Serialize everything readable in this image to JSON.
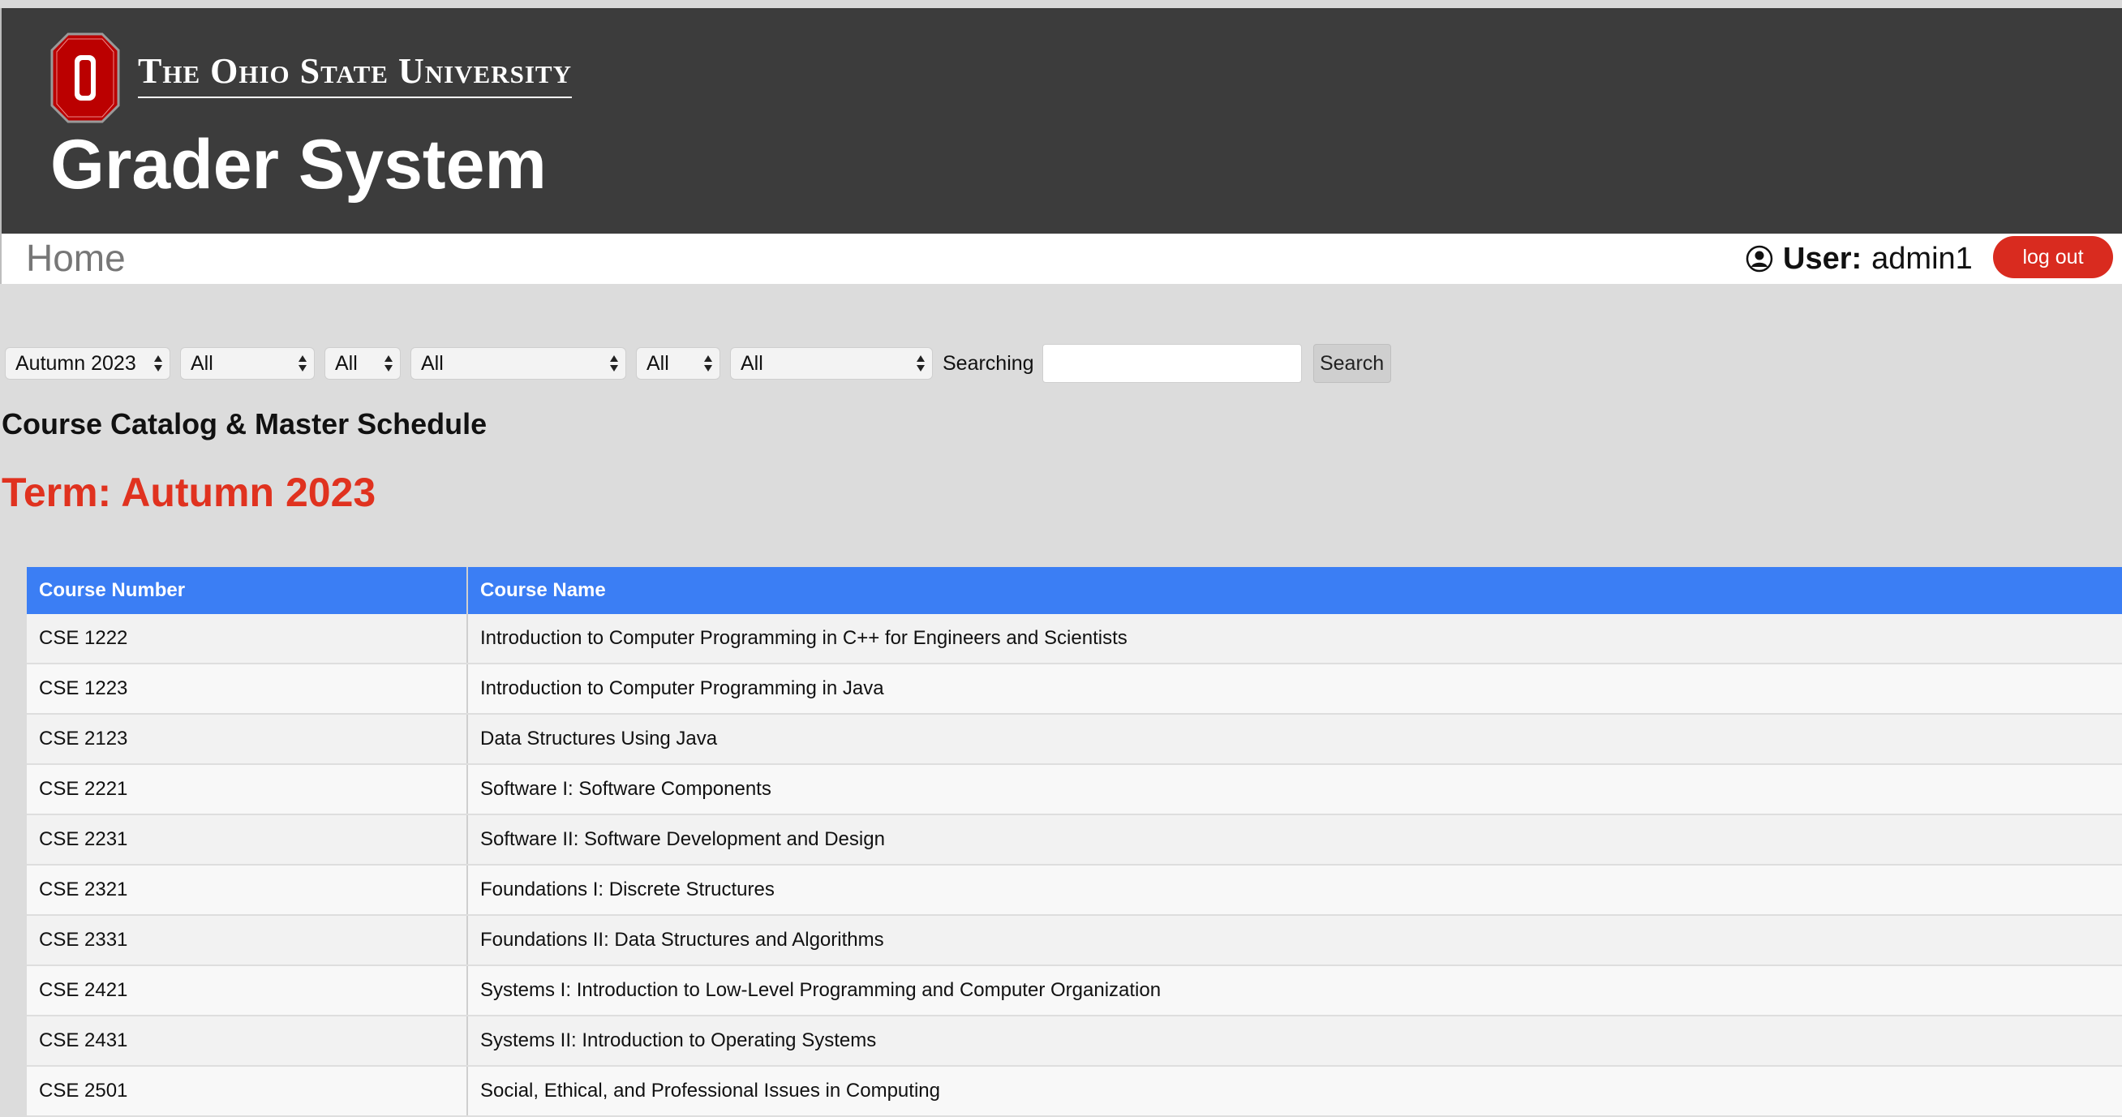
{
  "header": {
    "university": "The Ohio State University",
    "app_title": "Grader System"
  },
  "nav": {
    "home": "Home",
    "user_label": "User:",
    "user_name": "admin1",
    "logout": "log out"
  },
  "filters": {
    "term": "Autumn 2023",
    "f2": "All",
    "f3": "All",
    "f4": "All",
    "f5": "All",
    "f6": "All",
    "search_label": "Searching",
    "search_value": "",
    "search_button": "Search"
  },
  "page": {
    "heading": "Course Catalog & Master Schedule",
    "term_label": "Term:",
    "term_value": "Autumn 2023"
  },
  "table": {
    "headers": [
      "Course Number",
      "Course Name"
    ],
    "rows": [
      [
        "CSE 1222",
        "Introduction to Computer Programming in C++ for Engineers and Scientists"
      ],
      [
        "CSE 1223",
        "Introduction to Computer Programming in Java"
      ],
      [
        "CSE 2123",
        "Data Structures Using Java"
      ],
      [
        "CSE 2221",
        "Software I: Software Components"
      ],
      [
        "CSE 2231",
        "Software II: Software Development and Design"
      ],
      [
        "CSE 2321",
        "Foundations I: Discrete Structures"
      ],
      [
        "CSE 2331",
        "Foundations II: Data Structures and Algorithms"
      ],
      [
        "CSE 2421",
        "Systems I: Introduction to Low-Level Programming and Computer Organization"
      ],
      [
        "CSE 2431",
        "Systems II: Introduction to Operating Systems"
      ],
      [
        "CSE 2501",
        "Social, Ethical, and Professional Issues in Computing"
      ]
    ]
  },
  "colors": {
    "header_bg": "#3c3c3c",
    "accent_red": "#e0321f",
    "table_header": "#3b7ef4",
    "logout_red": "#d92b1f"
  },
  "icons": [
    "block-o-logo",
    "user-circle-icon",
    "select-arrows-icon"
  ]
}
